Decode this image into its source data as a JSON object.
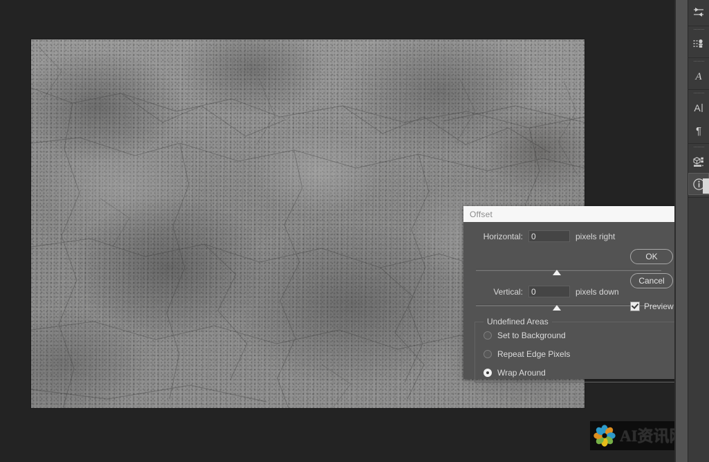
{
  "app": {
    "workspace_bg": "#232323",
    "canvas": {
      "name": "concrete-texture-document",
      "description": "Gray weathered concrete texture photograph"
    }
  },
  "right_rail": {
    "groups": [
      {
        "name": "adjustments-group",
        "items": [
          {
            "icon": "adjustments-sliders-icon",
            "label": "Adjustments",
            "active": false
          }
        ]
      },
      {
        "name": "styles-group",
        "items": [
          {
            "icon": "styles-stamp-icon",
            "label": "Styles",
            "active": false
          }
        ]
      },
      {
        "name": "character-group",
        "items": [
          {
            "icon": "character-a-icon",
            "label": "Character Styles",
            "active": false
          }
        ]
      },
      {
        "name": "type-group",
        "items": [
          {
            "icon": "character-panel-icon",
            "label": "Character",
            "active": false
          },
          {
            "icon": "paragraph-pilcrow-icon",
            "label": "Paragraph",
            "active": false
          }
        ]
      },
      {
        "name": "library-group",
        "items": [
          {
            "icon": "libraries-cube-icon",
            "label": "Libraries",
            "active": false
          },
          {
            "icon": "info-circle-icon",
            "label": "Info",
            "active": true
          }
        ]
      }
    ]
  },
  "dialog": {
    "title": "Offset",
    "close_label": "×",
    "horizontal": {
      "label": "Horizontal:",
      "value": "0",
      "placeholder": "0",
      "unit": "pixels right",
      "slider_percent": 50
    },
    "vertical": {
      "label": "Vertical:",
      "value": "0",
      "placeholder": "0",
      "unit": "pixels down",
      "slider_percent": 50
    },
    "buttons": {
      "ok": "OK",
      "cancel": "Cancel"
    },
    "preview": {
      "label": "Preview",
      "checked": true
    },
    "undefined_areas": {
      "legend": "Undefined Areas",
      "options": [
        {
          "label": "Set to Background",
          "selected": false
        },
        {
          "label": "Repeat Edge Pixels",
          "selected": false
        },
        {
          "label": "Wrap Around",
          "selected": true
        }
      ]
    }
  },
  "watermark": {
    "text": "AI资讯网",
    "logo": "flower-logo-icon",
    "petal_colors": [
      "#2f9fd0",
      "#e8941f",
      "#7ab648",
      "#f0c419",
      "#2f9fd0",
      "#e8941f",
      "#7ab648",
      "#f0c419"
    ]
  }
}
